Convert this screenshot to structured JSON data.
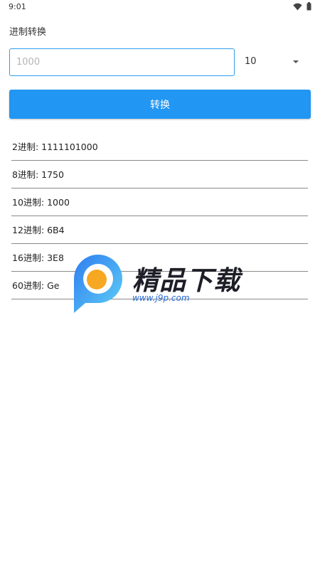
{
  "status_bar": {
    "time": "9:01",
    "icons": [
      "wifi-icon",
      "battery-icon"
    ]
  },
  "page": {
    "title": "进制转换"
  },
  "input": {
    "placeholder": "1000",
    "value": ""
  },
  "base_select": {
    "selected": "10",
    "icon": "chevron-down-icon"
  },
  "convert_button": {
    "label": "转换",
    "color": "#2196f3"
  },
  "results": [
    {
      "label": "2进制: 1111101000"
    },
    {
      "label": "8进制: 1750"
    },
    {
      "label": "10进制: 1000"
    },
    {
      "label": "12进制: 6B4"
    },
    {
      "label": "16进制: 3E8"
    },
    {
      "label": "60进制: Ge"
    }
  ],
  "watermark": {
    "text": "精品下载",
    "url": "www.j9p.com"
  },
  "colors": {
    "accent": "#2196f3",
    "input_border": "#2f9cf0",
    "divider": "#8a8a8a"
  }
}
